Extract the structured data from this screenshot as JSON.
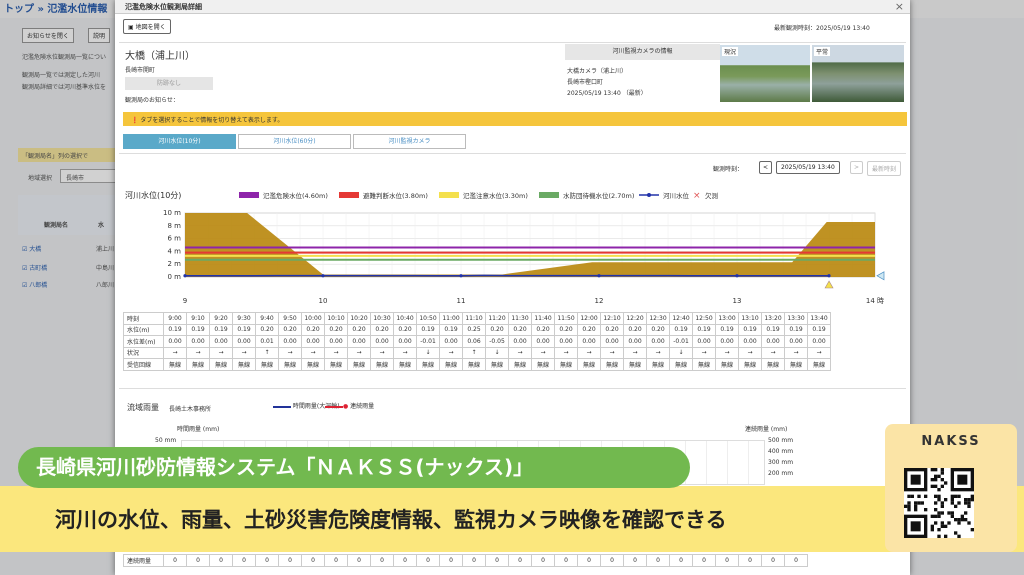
{
  "background": {
    "breadcrumb": "トップ » 氾濫水位情報",
    "buttons": [
      "お知らせを閉く",
      "説明"
    ],
    "intro_lines": [
      "氾濫危険水位観測局一覧につい",
      "観測局一覧では測定した河川",
      "観測局詳細では河川基準水位を"
    ],
    "note": "「観測局名」列の選択で",
    "area_label": "地域選択",
    "area_value": "長崎市",
    "col_header": "観測局名",
    "col_header2": "水",
    "stations": [
      {
        "name": "大橋",
        "river": "浦上川"
      },
      {
        "name": "古町橋",
        "river": "中島川"
      },
      {
        "name": "八郎橋",
        "river": "八郎川"
      }
    ]
  },
  "modal": {
    "title": "氾濫危険水位観測局詳細",
    "open_map_label": "地図を開く",
    "latest_time_label": "最新観測時刻：",
    "latest_time": "2025/05/19 13:40",
    "station": {
      "name": "大橋（浦上川）",
      "office": "長崎市開町",
      "disabled_btn": "防跡なし",
      "notice_label": "観測局のお知らせ："
    },
    "camera": {
      "header": "河川監視カメラの情報",
      "name": "大橋カメラ（浦上川）",
      "location": "長崎市樫口町",
      "time": "2025/05/19 13:40 （最新）",
      "photo1_label": "現況",
      "photo2_label": "平常"
    },
    "banner": "タブを選択することで情報を切り替えて表示します。",
    "tabs": [
      "河川水位(10分)",
      "河川水位(60分)",
      "河川監視カメラ"
    ],
    "time_control": {
      "label": "観測時刻：",
      "prev": "<",
      "value": "2025/05/19 13:40",
      "next": ">",
      "latest": "最新時刻"
    },
    "chart_title": "河川水位(10分)",
    "rain_section": {
      "title": "流域雨量",
      "office": "長崎土木事務所",
      "left_axis_title": "時間雨量 (mm)",
      "right_axis_title": "連続雨量 (mm)",
      "left_ticks": [
        "50 mm"
      ],
      "right_ticks": [
        "500 mm",
        "400 mm",
        "300 mm",
        "200 mm"
      ],
      "legend": [
        "時間雨量(大深輪)",
        "連続雨量"
      ],
      "row_label": "連続雨量",
      "row_values": [
        "0",
        "0",
        "0",
        "0",
        "0",
        "0",
        "0",
        "0",
        "0",
        "0",
        "0",
        "0",
        "0",
        "0",
        "0",
        "0",
        "0",
        "0",
        "0",
        "0",
        "0",
        "0",
        "0",
        "0",
        "0",
        "0",
        "0",
        "0"
      ]
    }
  },
  "table": {
    "row_labels": [
      "時刻",
      "水位(m)",
      "水位差(m)",
      "状況",
      "受信回線"
    ],
    "times": [
      "9:00",
      "9:10",
      "9:20",
      "9:30",
      "9:40",
      "9:50",
      "10:00",
      "10:10",
      "10:20",
      "10:30",
      "10:40",
      "10:50",
      "11:00",
      "11:10",
      "11:20",
      "11:30",
      "11:40",
      "11:50",
      "12:00",
      "12:10",
      "12:20",
      "12:30",
      "12:40",
      "12:50",
      "13:00",
      "13:10",
      "13:20",
      "13:30",
      "13:40"
    ],
    "levels": [
      "0.19",
      "0.19",
      "0.19",
      "0.19",
      "0.20",
      "0.20",
      "0.20",
      "0.20",
      "0.20",
      "0.20",
      "0.20",
      "0.19",
      "0.19",
      "0.25",
      "0.20",
      "0.20",
      "0.20",
      "0.20",
      "0.20",
      "0.20",
      "0.20",
      "0.20",
      "0.19",
      "0.19",
      "0.19",
      "0.19",
      "0.19",
      "0.19",
      "0.19"
    ],
    "diffs": [
      "0.00",
      "0.00",
      "0.00",
      "0.00",
      "0.01",
      "0.00",
      "0.00",
      "0.00",
      "0.00",
      "0.00",
      "0.00",
      "-0.01",
      "0.00",
      "0.06",
      "-0.05",
      "0.00",
      "0.00",
      "0.00",
      "0.00",
      "0.00",
      "0.00",
      "0.00",
      "-0.01",
      "0.00",
      "0.00",
      "0.00",
      "0.00",
      "0.00",
      "0.00"
    ],
    "status": [
      "→",
      "→",
      "→",
      "→",
      "↑",
      "→",
      "→",
      "→",
      "→",
      "→",
      "→",
      "↓",
      "→",
      "↑",
      "↓",
      "→",
      "→",
      "→",
      "→",
      "→",
      "→",
      "→",
      "↓",
      "→",
      "→",
      "→",
      "→",
      "→",
      "→"
    ],
    "line": "無線"
  },
  "chart_data": {
    "type": "line",
    "title": "河川水位(10分)",
    "ylabel": "",
    "xlabel": "",
    "ylim": [
      0,
      10
    ],
    "xlim": [
      9,
      14
    ],
    "y_ticks": [
      "10 m",
      "8 m",
      "6 m",
      "4 m",
      "2 m",
      "0 m"
    ],
    "x_ticks": [
      "9",
      "10",
      "11",
      "12",
      "13",
      "14 時"
    ],
    "thresholds": [
      {
        "name": "氾濫危険水位(4.60m)",
        "value": 4.6,
        "color": "#8e24aa"
      },
      {
        "name": "避難判断水位(3.80m)",
        "value": 3.8,
        "color": "#e53935"
      },
      {
        "name": "氾濫注意水位(3.30m)",
        "value": 3.3,
        "color": "#f4e04d"
      },
      {
        "name": "水防団待機水位(2.70m)",
        "value": 2.7,
        "color": "#6aaa64"
      }
    ],
    "series": [
      {
        "name": "河川水位",
        "color": "#2233aa",
        "x": [
          9.0,
          9.1667,
          9.3333,
          9.5,
          9.6667,
          9.8333,
          10.0,
          10.1667,
          10.3333,
          10.5,
          10.6667,
          10.8333,
          11.0,
          11.1667,
          11.3333,
          11.5,
          11.6667,
          11.8333,
          12.0,
          12.1667,
          12.3333,
          12.5,
          12.6667,
          12.8333,
          13.0,
          13.1667,
          13.3333,
          13.5,
          13.6667
        ],
        "y": [
          0.19,
          0.19,
          0.19,
          0.19,
          0.2,
          0.2,
          0.2,
          0.2,
          0.2,
          0.2,
          0.2,
          0.19,
          0.19,
          0.25,
          0.2,
          0.2,
          0.2,
          0.2,
          0.2,
          0.2,
          0.2,
          0.2,
          0.19,
          0.19,
          0.19,
          0.19,
          0.19,
          0.19,
          0.19
        ]
      }
    ],
    "bank_profile": {
      "x": [
        9,
        9.45,
        10.0,
        11.3,
        11.95,
        12.3,
        13.4,
        13.65,
        14
      ],
      "y": [
        10,
        10,
        0.4,
        0.4,
        2.3,
        2.3,
        2.3,
        8.6,
        8.6
      ],
      "color": "#b8860b"
    },
    "legend_extra": "欠測",
    "legend_position": "top"
  },
  "overlay": {
    "headline": "長崎県河川砂防情報システム「ＮＡＫＳＳ(ナックス)」",
    "subline": "河川の水位、雨量、土砂災害危険度情報、監視カメラ映像を確認できる",
    "qr_title": "NAKSS"
  }
}
